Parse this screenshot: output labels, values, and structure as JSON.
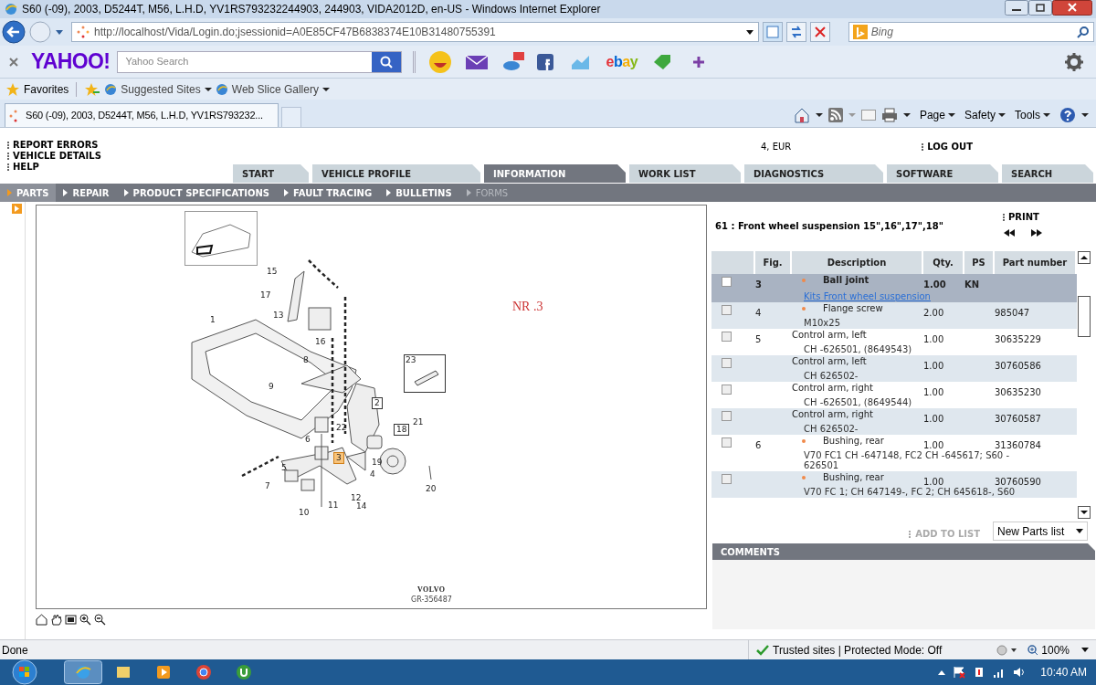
{
  "window": {
    "title": "S60 (-09), 2003, D5244T, M56, L.H.D, YV1RS793232244903, 244903, VIDA2012D, en-US - Windows Internet Explorer"
  },
  "browser": {
    "address": "http://localhost/Vida/Login.do;jsessionid=A0E85CF47B6838374E10B31480755391",
    "search_engine": "Bing",
    "yahoo_logo": "YAHOO!",
    "yahoo_search": {
      "placeholder": "Yahoo Search"
    },
    "ebay": "ebay",
    "favorites": "Favorites",
    "favorite_links": [
      "Suggested Sites",
      "Web Slice Gallery"
    ],
    "tabs": [
      {
        "label": "S60 (-09), 2003, D5244T, M56, L.H.D, YV1RS793232...",
        "selected": true
      }
    ],
    "command_menus": [
      "Page",
      "Safety",
      "Tools"
    ]
  },
  "page": {
    "top_links": [
      "REPORT ERRORS",
      "VEHICLE DETAILS",
      "HELP"
    ],
    "locale": "4, EUR",
    "logout": "LOG OUT",
    "tabs": [
      {
        "label": "START",
        "selected": false
      },
      {
        "label": "VEHICLE PROFILE",
        "selected": false
      },
      {
        "label": "INFORMATION",
        "selected": true
      },
      {
        "label": "WORK LIST",
        "selected": false
      },
      {
        "label": "DIAGNOSTICS",
        "selected": false
      },
      {
        "label": "SOFTWARE",
        "selected": false
      },
      {
        "label": "SEARCH",
        "selected": false
      }
    ],
    "subnav": [
      {
        "label": "PARTS",
        "selected": true,
        "disabled": false
      },
      {
        "label": "REPAIR",
        "selected": false,
        "disabled": false
      },
      {
        "label": "PRODUCT SPECIFICATIONS",
        "selected": false,
        "disabled": false
      },
      {
        "label": "FAULT TRACING",
        "selected": false,
        "disabled": false
      },
      {
        "label": "BULLETINS",
        "selected": false,
        "disabled": false
      },
      {
        "label": "FORMS",
        "selected": false,
        "disabled": true
      }
    ]
  },
  "diagram": {
    "callouts": [
      {
        "label": "1",
        "kind": "plain"
      },
      {
        "label": "15",
        "kind": "plain"
      },
      {
        "label": "17",
        "kind": "plain"
      },
      {
        "label": "13",
        "kind": "plain"
      },
      {
        "label": "16",
        "kind": "plain"
      },
      {
        "label": "8",
        "kind": "plain"
      },
      {
        "label": "9",
        "kind": "plain"
      },
      {
        "label": "23",
        "kind": "plain"
      },
      {
        "label": "2",
        "kind": "boxed"
      },
      {
        "label": "22",
        "kind": "plain"
      },
      {
        "label": "18",
        "kind": "boxed"
      },
      {
        "label": "21",
        "kind": "plain"
      },
      {
        "label": "6",
        "kind": "plain"
      },
      {
        "label": "3",
        "kind": "highlight"
      },
      {
        "label": "19",
        "kind": "plain"
      },
      {
        "label": "5",
        "kind": "plain"
      },
      {
        "label": "4",
        "kind": "plain"
      },
      {
        "label": "7",
        "kind": "plain"
      },
      {
        "label": "12",
        "kind": "plain"
      },
      {
        "label": "11",
        "kind": "plain"
      },
      {
        "label": "14",
        "kind": "plain"
      },
      {
        "label": "20",
        "kind": "plain"
      },
      {
        "label": "10",
        "kind": "plain"
      }
    ],
    "note": "NR .3",
    "brand": "VOLVO",
    "drawing_number": "GR-356487"
  },
  "parts": {
    "title": "61 : Front wheel suspension 15\",16\",17\",18\"",
    "print": "PRINT",
    "columns": [
      "Fig.",
      "Description",
      "Qty.",
      "PS",
      "Part number"
    ],
    "rows": [
      {
        "checked": false,
        "selected": true,
        "fig": "3",
        "marker": true,
        "description": "Ball joint",
        "qty": "1.00",
        "ps": "KN",
        "link": "Kits Front wheel suspension"
      },
      {
        "checked": false,
        "selected": false,
        "fig": "4",
        "marker": true,
        "description": "Flange screw",
        "qty": "2.00",
        "part_number": "985047",
        "detail": "M10x25"
      },
      {
        "checked": false,
        "selected": false,
        "fig": "5",
        "marker": false,
        "description": "Control arm, left",
        "qty": "1.00",
        "part_number": "30635229",
        "detail": "CH -626501, (8649543)"
      },
      {
        "checked": false,
        "selected": false,
        "marker": false,
        "description": "Control arm, left",
        "qty": "1.00",
        "part_number": "30760586",
        "detail": "CH 626502-"
      },
      {
        "checked": false,
        "selected": false,
        "marker": false,
        "description": "Control arm, right",
        "qty": "1.00",
        "part_number": "30635230",
        "detail": "CH -626501, (8649544)"
      },
      {
        "checked": false,
        "selected": false,
        "marker": false,
        "description": "Control arm, right",
        "qty": "1.00",
        "part_number": "30760587",
        "detail": "CH 626502-"
      },
      {
        "checked": false,
        "selected": false,
        "fig": "6",
        "marker": true,
        "description": "Bushing, rear",
        "qty": "1.00",
        "part_number": "31360784",
        "detail": "V70 FC1 CH -647148, FC2 CH -645617; S60 - 626501"
      },
      {
        "checked": false,
        "selected": false,
        "marker": true,
        "description": "Bushing, rear",
        "qty": "1.00",
        "part_number": "30760590",
        "detail": "V70 FC 1; CH 647149-, FC 2; CH 645618-, S60"
      }
    ],
    "add_to_list": "ADD TO LIST",
    "list_select": "New Parts list",
    "comments": "COMMENTS"
  },
  "status_bar": {
    "text": "Done",
    "zone": "Trusted sites | Protected Mode: Off",
    "zoom": "100%"
  },
  "taskbar": {
    "clock": "10:40 AM"
  }
}
